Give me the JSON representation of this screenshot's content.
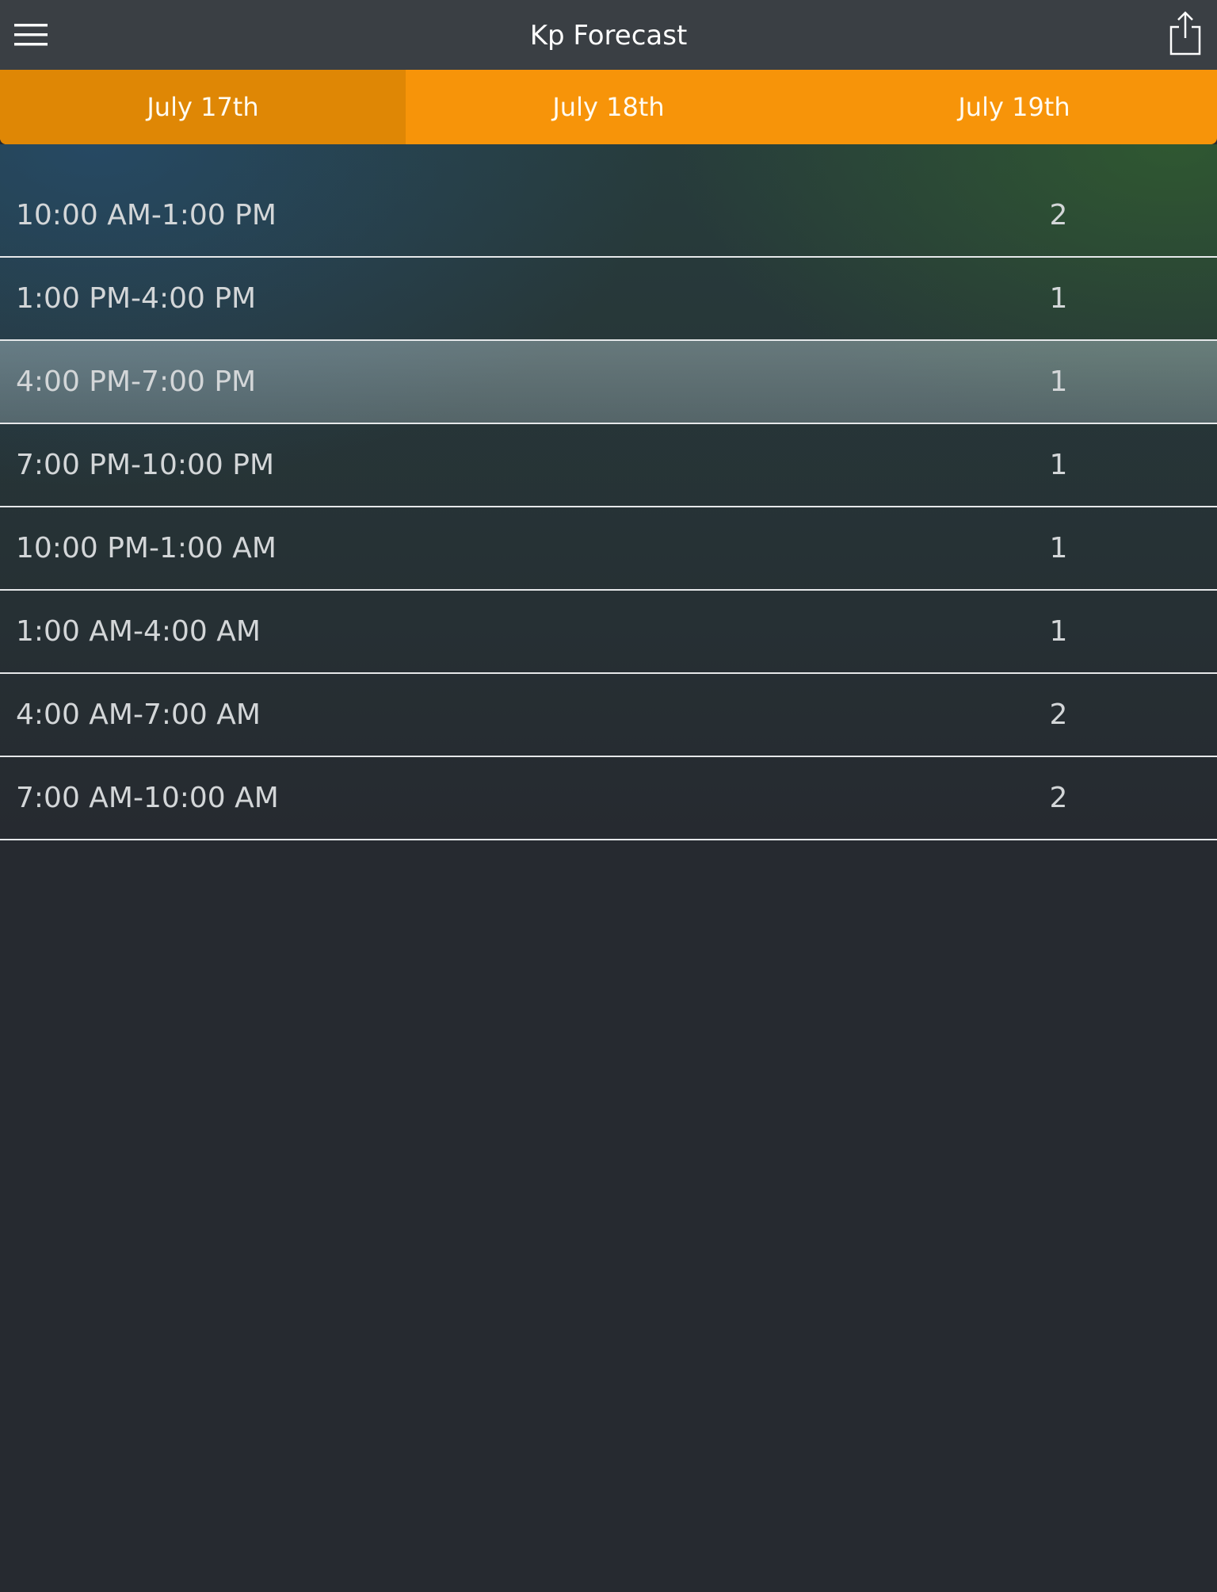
{
  "header": {
    "title": "Kp Forecast",
    "menu_icon": "hamburger-menu-icon",
    "share_icon": "share-icon"
  },
  "tabs": [
    {
      "label": "July 17th",
      "active": true
    },
    {
      "label": "July 18th",
      "active": false
    },
    {
      "label": "July 19th",
      "active": false
    }
  ],
  "forecast": [
    {
      "period": "10:00 AM-1:00 PM",
      "kp": "2"
    },
    {
      "period": "1:00 PM-4:00 PM",
      "kp": "1"
    },
    {
      "period": "4:00 PM-7:00 PM",
      "kp": "1",
      "highlighted": true
    },
    {
      "period": "7:00 PM-10:00 PM",
      "kp": "1"
    },
    {
      "period": "10:00 PM-1:00 AM",
      "kp": "1"
    },
    {
      "period": "1:00 AM-4:00 AM",
      "kp": "1"
    },
    {
      "period": "4:00 AM-7:00 AM",
      "kp": "2"
    },
    {
      "period": "7:00 AM-10:00 AM",
      "kp": "2"
    }
  ],
  "colors": {
    "accent": "#f79409",
    "accent_active": "#df8705",
    "header_bg": "#3a3f44",
    "page_bg": "#262a30"
  }
}
